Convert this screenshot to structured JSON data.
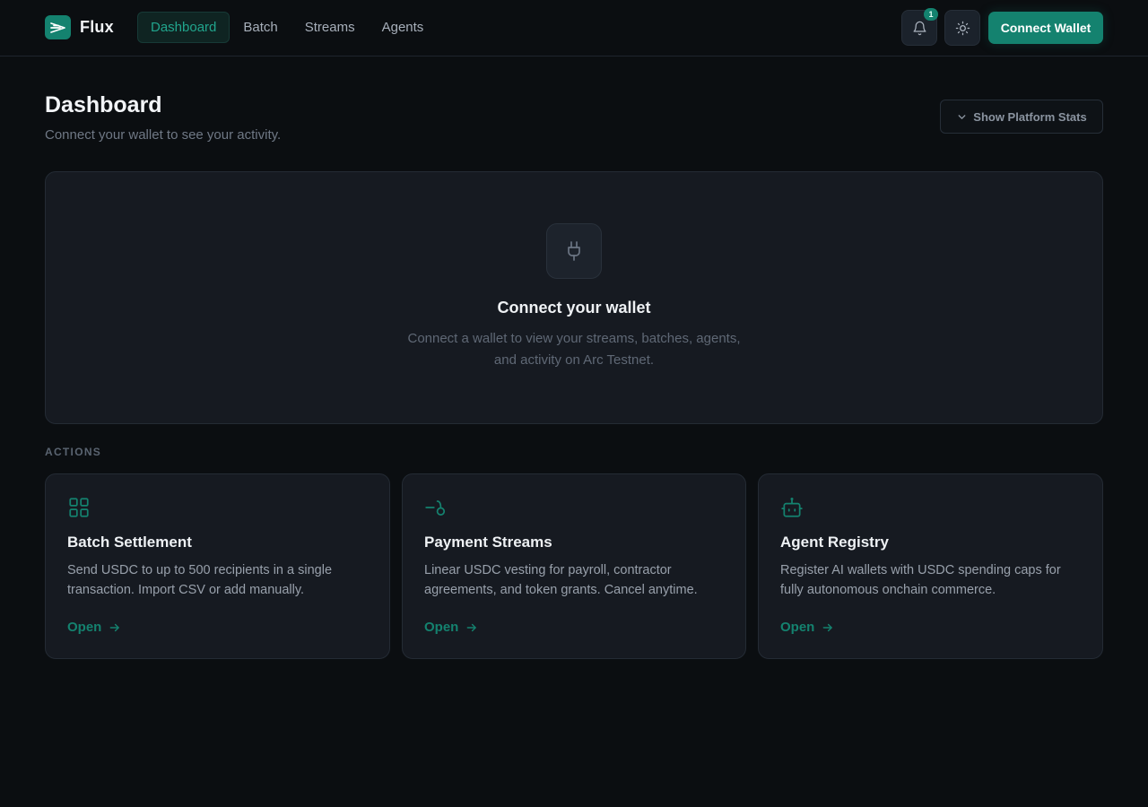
{
  "header": {
    "brand_name": "Flux",
    "nav": [
      "Dashboard",
      "Batch",
      "Streams",
      "Agents"
    ],
    "notification_count": "1",
    "connect_label": "Connect Wallet"
  },
  "page": {
    "title": "Dashboard",
    "subtitle": "Connect your wallet to see your activity.",
    "stats_toggle_label": "Show Platform Stats"
  },
  "empty_state": {
    "icon": "plug-icon",
    "title": "Connect your wallet",
    "text": "Connect a wallet to view your streams, batches, agents, and activity on Arc Testnet."
  },
  "actions": {
    "section_label": "ACTIONS",
    "cards": [
      {
        "icon": "grid-icon",
        "title": "Batch Settlement",
        "description": "Send USDC to up to 500 recipients in a single transaction. Import CSV or add manually.",
        "link_label": "Open"
      },
      {
        "icon": "stream-icon",
        "title": "Payment Streams",
        "description": "Linear USDC vesting for payroll, contractor agreements, and token grants. Cancel anytime.",
        "link_label": "Open"
      },
      {
        "icon": "bot-icon",
        "title": "Agent Registry",
        "description": "Register AI wallets with USDC spending caps for fully autonomous onchain commerce.",
        "link_label": "Open"
      }
    ]
  },
  "colors": {
    "accent": "#14826f",
    "accent_text": "#21a58d",
    "background": "#0b0e11",
    "card": "#161a21"
  }
}
